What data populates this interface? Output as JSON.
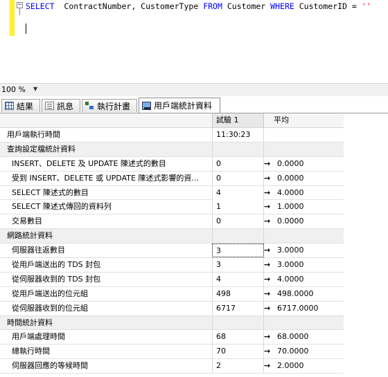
{
  "editor": {
    "sql_select": "SELECT",
    "sql_columns": "  ContractNumber, CustomerType",
    "sql_from": "FROM",
    "sql_table": "Customer",
    "sql_where": "WHERE",
    "sql_cond": "CustomerID =",
    "sql_literal": "''",
    "collapse_glyph": "−"
  },
  "zoom": {
    "value": "100 %"
  },
  "tabs": [
    {
      "label": "結果",
      "icon": "grid-icon"
    },
    {
      "label": "訊息",
      "icon": "messages-icon"
    },
    {
      "label": "執行計畫",
      "icon": "execution-plan-icon"
    },
    {
      "label": "用戶端統計資料",
      "icon": "client-statistics-icon",
      "active": true
    }
  ],
  "grid": {
    "columns": [
      "試驗 1",
      "平均"
    ],
    "arrow": "→",
    "rows": [
      {
        "type": "top",
        "label": "用戶端執行時間",
        "value": "11:30:23",
        "avg": ""
      },
      {
        "type": "section",
        "label": "查詢設定檔統計資料"
      },
      {
        "type": "item",
        "label": "INSERT、DELETE 及 UPDATE 陳述式的數目",
        "value": "0",
        "avg": "0.0000"
      },
      {
        "type": "item",
        "label": "受到 INSERT、DELETE 或 UPDATE 陳述式影響的資...",
        "value": "0",
        "avg": "0.0000"
      },
      {
        "type": "item",
        "label": "SELECT 陳述式的數目",
        "value": "4",
        "avg": "4.0000"
      },
      {
        "type": "item",
        "label": "SELECT 陳述式傳回的資料列",
        "value": "1",
        "avg": "1.0000"
      },
      {
        "type": "item",
        "label": "交易數目",
        "value": "0",
        "avg": "0.0000"
      },
      {
        "type": "section",
        "label": "網路統計資料"
      },
      {
        "type": "item",
        "label": "伺服器往返數目",
        "value": "3",
        "avg": "3.0000",
        "selected": true
      },
      {
        "type": "item",
        "label": "從用戶端送出的 TDS 封包",
        "value": "3",
        "avg": "3.0000"
      },
      {
        "type": "item",
        "label": "從伺服器收到的 TDS 封包",
        "value": "4",
        "avg": "4.0000"
      },
      {
        "type": "item",
        "label": "從用戶端送出的位元組",
        "value": "498",
        "avg": "498.0000"
      },
      {
        "type": "item",
        "label": "從伺服器收到的位元組",
        "value": "6717",
        "avg": "6717.0000"
      },
      {
        "type": "section",
        "label": "時間統計資料"
      },
      {
        "type": "item",
        "label": "用戶端處理時間",
        "value": "68",
        "avg": "68.0000"
      },
      {
        "type": "item",
        "label": "總執行時間",
        "value": "70",
        "avg": "70.0000"
      },
      {
        "type": "item",
        "label": "伺服器回應的等候時間",
        "value": "2",
        "avg": "2.0000"
      }
    ]
  }
}
